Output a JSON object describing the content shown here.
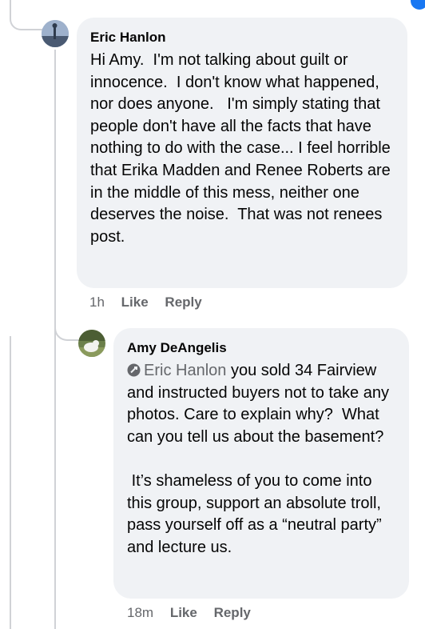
{
  "comment1": {
    "author": "Eric Hanlon",
    "body": "Hi Amy.  I'm not talking about guilt or innocence.  I don't know what happened, nor does anyone.   I'm simply stating that people don't have all the facts that have nothing to do with the case... I feel horrible that Erika Madden and Renee Roberts are in the middle of this mess, neither one deserves the noise.  That was not renees post.",
    "time": "1h",
    "like_label": "Like",
    "reply_label": "Reply"
  },
  "comment2": {
    "author": "Amy DeAngelis",
    "mention_icon": "reply-mention-icon",
    "mention": "Eric Hanlon",
    "body": " you sold 34 Fairview and instructed buyers not to take any photos. Care to explain why?  What can you tell us about the basement?\n\n It’s shameless of you to come into this group, support an absolute troll, pass yourself off as a “neutral party” and lecture us.",
    "time": "18m",
    "like_label": "Like",
    "reply_label": "Reply"
  },
  "colors": {
    "bubble": "#f0f2f5",
    "secondary_text": "#65676b",
    "thread_line": "#d0d2d6",
    "accent": "#1877f2"
  }
}
